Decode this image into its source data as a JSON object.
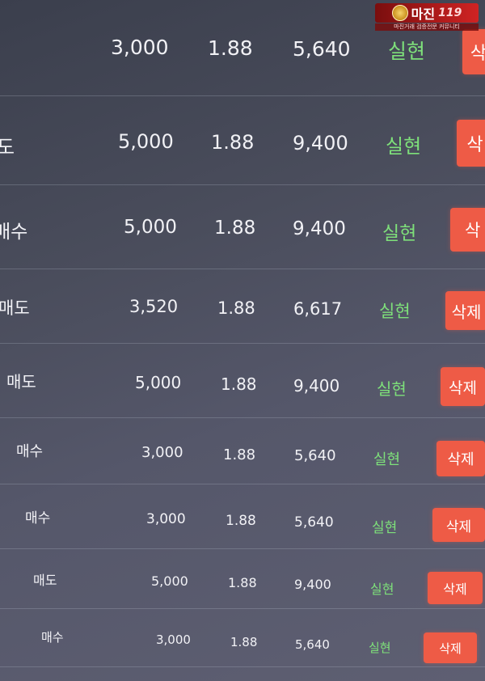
{
  "trades": [
    {
      "type": "",
      "quantity": "3,000",
      "rate": "1.88",
      "amount": "5,640",
      "status": "실현",
      "delete_label": "삭"
    },
    {
      "type": "도",
      "quantity": "5,000",
      "rate": "1.88",
      "amount": "9,400",
      "status": "실현",
      "delete_label": "삭"
    },
    {
      "type": "매수",
      "quantity": "5,000",
      "rate": "1.88",
      "amount": "9,400",
      "status": "실현",
      "delete_label": "삭"
    },
    {
      "type": "매도",
      "quantity": "3,520",
      "rate": "1.88",
      "amount": "6,617",
      "status": "실현",
      "delete_label": "삭제"
    },
    {
      "type": "매도",
      "quantity": "5,000",
      "rate": "1.88",
      "amount": "9,400",
      "status": "실현",
      "delete_label": "삭제"
    },
    {
      "type": "매수",
      "quantity": "3,000",
      "rate": "1.88",
      "amount": "5,640",
      "status": "실현",
      "delete_label": "삭제"
    },
    {
      "type": "매수",
      "quantity": "3,000",
      "rate": "1.88",
      "amount": "5,640",
      "status": "실현",
      "delete_label": "삭제"
    },
    {
      "type": "매도",
      "quantity": "5,000",
      "rate": "1.88",
      "amount": "9,400",
      "status": "실현",
      "delete_label": "삭제"
    },
    {
      "type": "매수",
      "quantity": "3,000",
      "rate": "1.88",
      "amount": "5,640",
      "status": "실현",
      "delete_label": "삭제"
    }
  ],
  "watermark": {
    "name": "마진",
    "number": "119",
    "tagline": "마진거래 검증전문 커뮤니티"
  },
  "colors": {
    "status": "#7ee07a",
    "delete_button": "#ee5b46"
  }
}
